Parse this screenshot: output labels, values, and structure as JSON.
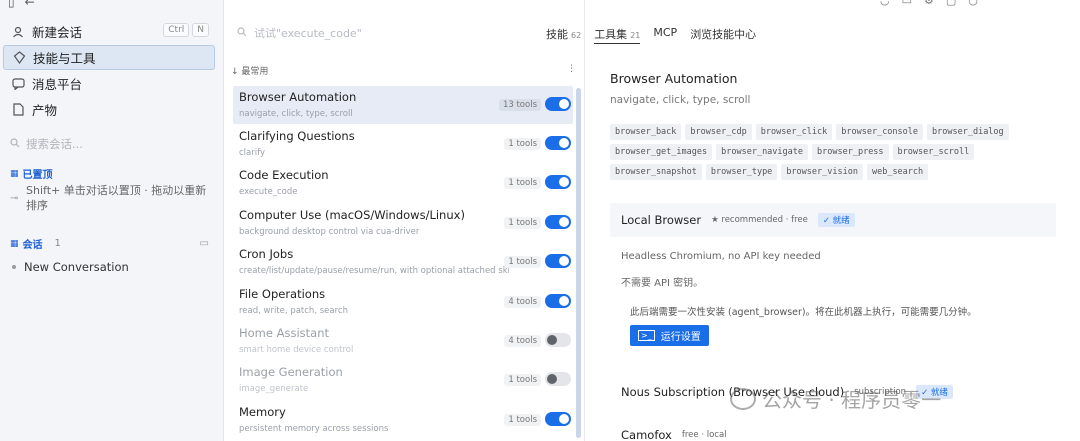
{
  "sidebar": {
    "shortcut": [
      "Ctrl",
      "N"
    ],
    "nav": [
      {
        "label": "新建会话",
        "icon": "new-chat-icon"
      },
      {
        "label": "技能与工具",
        "icon": "skills-icon"
      },
      {
        "label": "消息平台",
        "icon": "message-icon"
      },
      {
        "label": "产物",
        "icon": "document-icon"
      }
    ],
    "search_placeholder": "搜索会话...",
    "pinned_title": "已置顶",
    "pinned_hint": "Shift+ 单击对话以置顶 · 拖动以重新排序",
    "conversations_title": "会话",
    "conversations_count": "1",
    "conversations": [
      "New Conversation"
    ]
  },
  "middle": {
    "search_placeholder": "试试\"execute_code\"",
    "section_label": "↓ 最常用",
    "skills": [
      {
        "name": "Browser Automation",
        "desc": "navigate, click, type, scroll",
        "tools": "13 tools",
        "on": true
      },
      {
        "name": "Clarifying Questions",
        "desc": "clarify",
        "tools": "1 tools",
        "on": true
      },
      {
        "name": "Code Execution",
        "desc": "execute_code",
        "tools": "1 tools",
        "on": true
      },
      {
        "name": "Computer Use (macOS/Windows/Linux)",
        "desc": "background desktop control via cua-driver",
        "tools": "1 tools",
        "on": true
      },
      {
        "name": "Cron Jobs",
        "desc": "create/list/update/pause/resume/run, with optional attached skills",
        "tools": "1 tools",
        "on": true
      },
      {
        "name": "File Operations",
        "desc": "read, write, patch, search",
        "tools": "4 tools",
        "on": true
      },
      {
        "name": "Home Assistant",
        "desc": "smart home device control",
        "tools": "4 tools",
        "on": false
      },
      {
        "name": "Image Generation",
        "desc": "image_generate",
        "tools": "1 tools",
        "on": false
      },
      {
        "name": "Memory",
        "desc": "persistent memory across sessions",
        "tools": "1 tools",
        "on": true
      }
    ]
  },
  "header": {
    "tabs": [
      {
        "label": "技能",
        "count": "62"
      },
      {
        "label": "工具集",
        "count": "21"
      },
      {
        "label": "MCP",
        "count": ""
      },
      {
        "label": "浏览技能中心",
        "count": ""
      }
    ]
  },
  "detail": {
    "title": "Browser Automation",
    "subtitle": "navigate, click, type, scroll",
    "tools": [
      "browser_back",
      "browser_cdp",
      "browser_click",
      "browser_console",
      "browser_dialog",
      "browser_get_images",
      "browser_navigate",
      "browser_press",
      "browser_scroll",
      "browser_snapshot",
      "browser_type",
      "browser_vision",
      "web_search"
    ],
    "backend": {
      "name": "Local Browser",
      "meta": "★ recommended · free",
      "status": "✓ 就绪",
      "line1": "Headless Chromium, no API key needed",
      "line2": "不需要 API 密钥。",
      "setup_text": "此后端需要一次性安装 (agent_browser)。将在此机器上执行，可能需要几分钟。",
      "run_button": "运行设置"
    },
    "option2": {
      "name": "Nous Subscription (Browser Use cloud)",
      "meta": "subscription",
      "status": "✓ 就绪"
    },
    "option3": {
      "name": "Camofox",
      "meta": "free · local"
    }
  },
  "watermark": "公众号 · 程序员零一"
}
